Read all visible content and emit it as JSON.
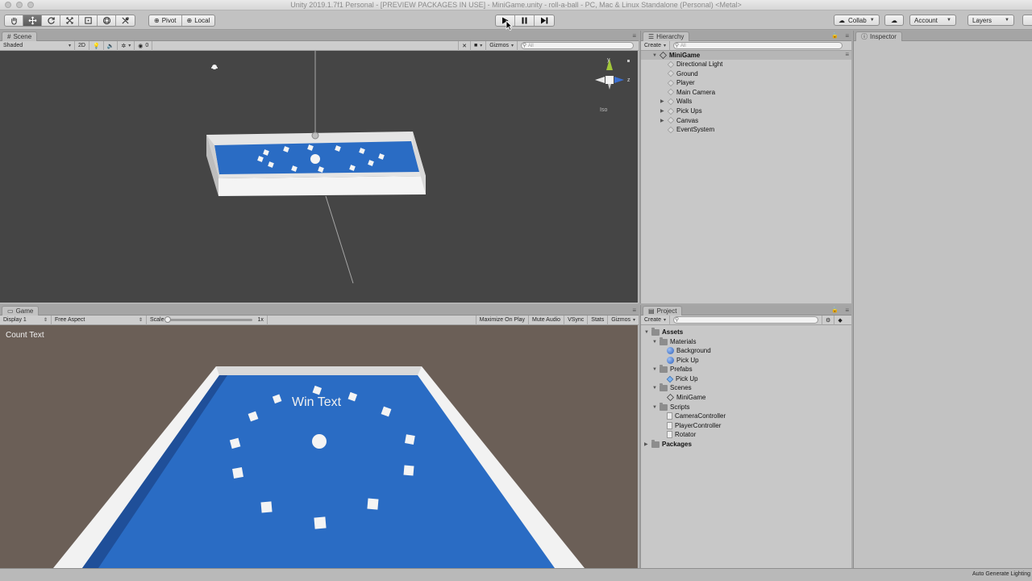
{
  "window": {
    "title": "Unity 2019.1.7f1 Personal - [PREVIEW PACKAGES IN USE] - MiniGame.unity - roll-a-ball - PC, Mac & Linux Standalone (Personal) <Metal>"
  },
  "toolbar": {
    "pivot_label": "Pivot",
    "local_label": "Local",
    "collab_label": "Collab",
    "account_label": "Account",
    "layers_label": "Layers"
  },
  "scene": {
    "tab_label": "Scene",
    "shading": "Shaded",
    "mode_2d": "2D",
    "fx_count": "0",
    "gizmos_label": "Gizmos",
    "search_placeholder": "All",
    "iso_label": "Iso",
    "axis_y": "y",
    "axis_z": "z"
  },
  "game": {
    "tab_label": "Game",
    "display": "Display 1",
    "aspect": "Free Aspect",
    "scale_label": "Scale",
    "scale_value": "1x",
    "maximize_label": "Maximize On Play",
    "mute_label": "Mute Audio",
    "vsync_label": "VSync",
    "stats_label": "Stats",
    "gizmos_label": "Gizmos",
    "count_text": "Count Text",
    "win_text": "Win Text"
  },
  "hierarchy": {
    "tab_label": "Hierarchy",
    "create_label": "Create",
    "search_placeholder": "All",
    "scene_name": "MiniGame",
    "items": [
      {
        "label": "Directional Light",
        "expandable": false
      },
      {
        "label": "Ground",
        "expandable": false
      },
      {
        "label": "Player",
        "expandable": false
      },
      {
        "label": "Main Camera",
        "expandable": false
      },
      {
        "label": "Walls",
        "expandable": true
      },
      {
        "label": "Pick Ups",
        "expandable": true
      },
      {
        "label": "Canvas",
        "expandable": true
      },
      {
        "label": "EventSystem",
        "expandable": false
      }
    ]
  },
  "project": {
    "tab_label": "Project",
    "create_label": "Create",
    "tree": {
      "assets": "Assets",
      "materials": "Materials",
      "background": "Background",
      "pickup_mat": "Pick Up",
      "prefabs": "Prefabs",
      "pickup_prefab": "Pick Up",
      "scenes": "Scenes",
      "minigame": "MiniGame",
      "scripts": "Scripts",
      "camera_controller": "CameraController",
      "player_controller": "PlayerController",
      "rotator": "Rotator",
      "packages": "Packages"
    }
  },
  "inspector": {
    "tab_label": "Inspector"
  },
  "status": {
    "text": "Auto Generate Lighting"
  },
  "colors": {
    "ground_blue": "#2a6cc4",
    "wall_white": "#f4f4f4",
    "scene_bg": "#454545",
    "game_bg": "#6b5f57"
  }
}
